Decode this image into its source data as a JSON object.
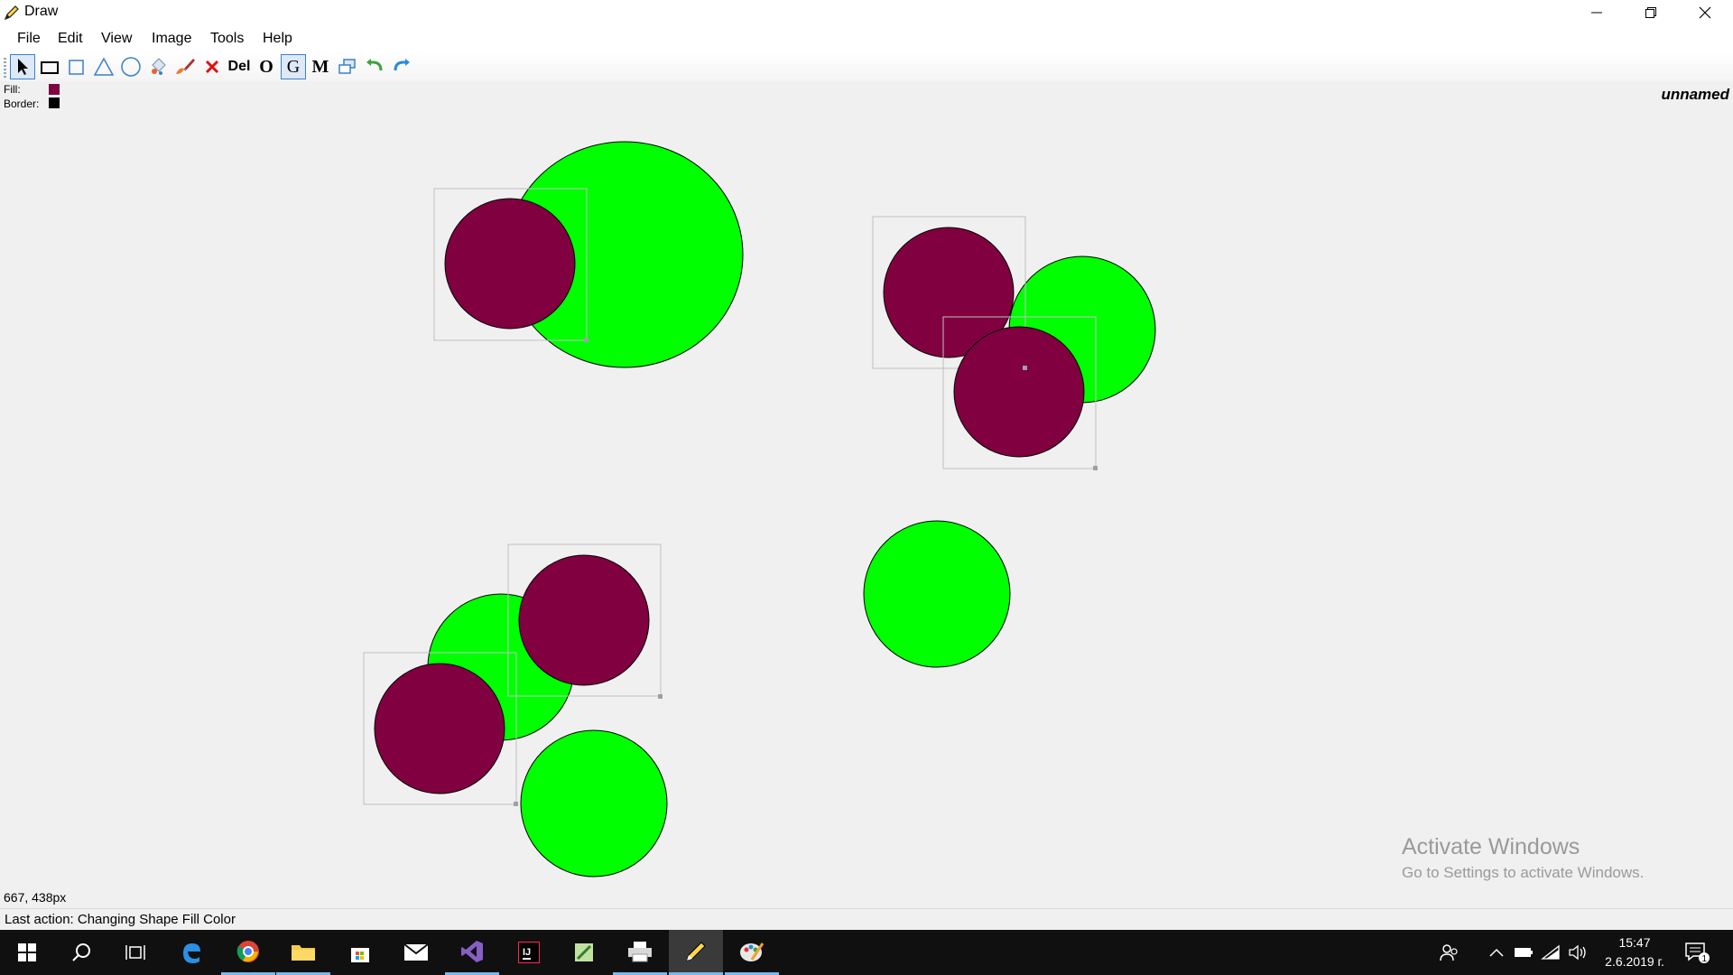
{
  "window": {
    "title": "Draw",
    "minimize_icon": "minimize-icon",
    "maximize_icon": "restore-icon",
    "close_icon": "close-icon"
  },
  "menu": {
    "items": [
      "File",
      "Edit",
      "View",
      "Image",
      "Tools",
      "Help"
    ]
  },
  "toolbar": {
    "tools": [
      {
        "name": "select-tool",
        "icon": "cursor-arrow-icon",
        "active": true
      },
      {
        "name": "rectangle-tool",
        "icon": "rectangle-icon"
      },
      {
        "name": "square-tool",
        "icon": "square-icon"
      },
      {
        "name": "triangle-tool",
        "icon": "triangle-icon"
      },
      {
        "name": "ellipse-tool",
        "icon": "ellipse-icon"
      },
      {
        "name": "fill-color-tool",
        "icon": "paint-bucket-icon"
      },
      {
        "name": "border-color-tool",
        "icon": "brush-icon"
      },
      {
        "name": "delete-tool",
        "icon": "red-x-icon"
      },
      {
        "name": "delete-all-tool",
        "label": "Del"
      },
      {
        "name": "o-tool",
        "label": "O"
      },
      {
        "name": "group-tool",
        "label": "G",
        "active": true
      },
      {
        "name": "m-tool",
        "label": "M"
      },
      {
        "name": "clone-tool",
        "icon": "duplicate-icon"
      },
      {
        "name": "undo-tool",
        "icon": "undo-icon"
      },
      {
        "name": "redo-tool",
        "icon": "redo-icon"
      }
    ]
  },
  "indicators": {
    "fill_label": "Fill:",
    "fill_color": "#800040",
    "border_label": "Border:",
    "border_color": "#000000"
  },
  "document_name": "unnamed",
  "colors": {
    "green": "#00ff00",
    "maroon": "#800040",
    "selection_box": "#c0c0c0",
    "taskbar_bg": "#101010",
    "taskbar_accent": "#76b9ed"
  },
  "watermark": {
    "title": "Activate Windows",
    "subtitle": "Go to Settings to activate Windows."
  },
  "cursor_coords": "667, 438px",
  "status": "Last action: Changing Shape Fill Color",
  "taskbar": {
    "items": [
      {
        "name": "start-icon"
      },
      {
        "name": "search-icon"
      },
      {
        "name": "task-view-icon"
      },
      {
        "name": "edge-icon"
      },
      {
        "name": "chrome-icon",
        "running": true
      },
      {
        "name": "file-explorer-icon",
        "running": true
      },
      {
        "name": "store-icon"
      },
      {
        "name": "mail-icon"
      },
      {
        "name": "visual-studio-icon",
        "running": true
      },
      {
        "name": "intellij-icon"
      },
      {
        "name": "notepad-icon"
      },
      {
        "name": "printer-icon",
        "running": true
      },
      {
        "name": "draw-app-icon",
        "running": true,
        "active": true
      },
      {
        "name": "paint-icon",
        "running": true
      }
    ],
    "tray": {
      "people_icon": "people-icon",
      "chevron_icon": "chevron-up-icon",
      "battery_icon": "battery-icon",
      "wifi_icon": "wifi-icon",
      "volume_icon": "volume-icon",
      "time": "15:47",
      "date": "2.6.2019 г.",
      "notification_count": "1"
    }
  }
}
